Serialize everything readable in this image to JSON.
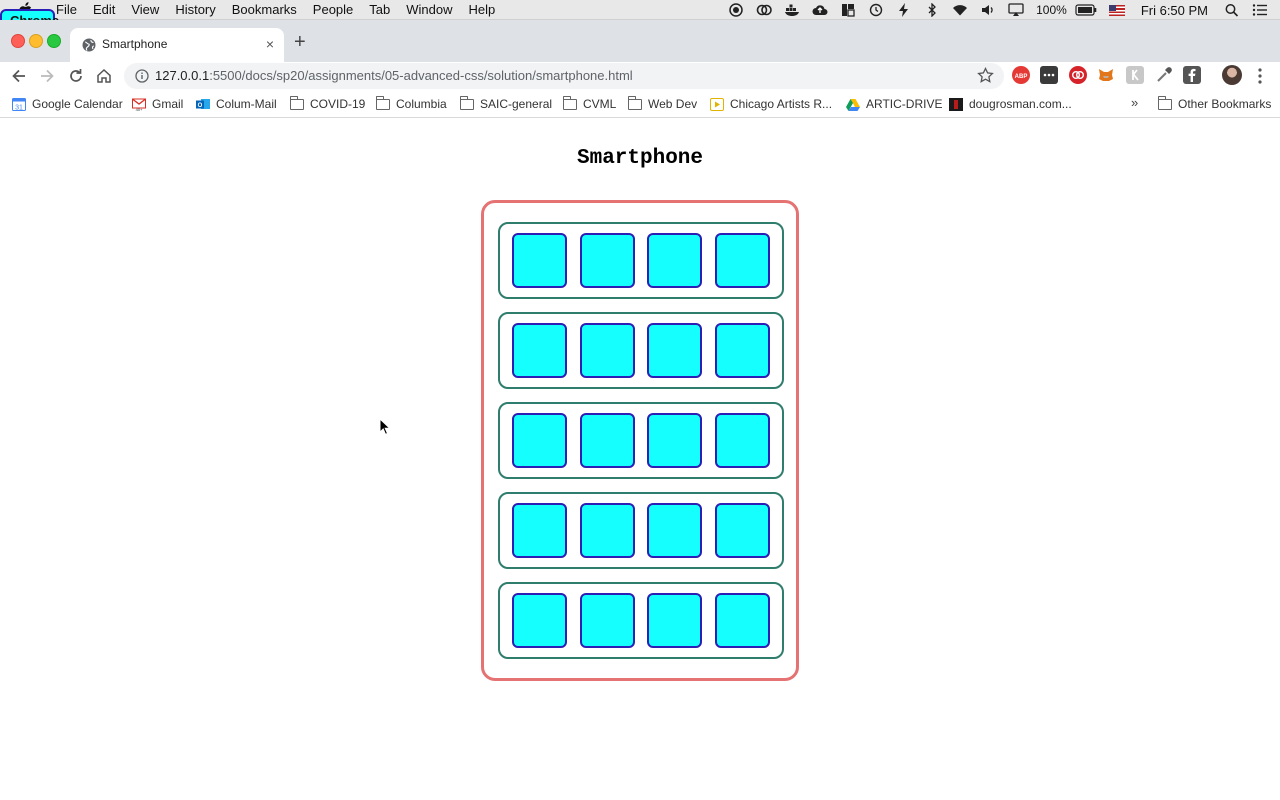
{
  "menubar": {
    "app_name": "Chrome",
    "items": [
      "File",
      "Edit",
      "View",
      "History",
      "Bookmarks",
      "People",
      "Tab",
      "Window",
      "Help"
    ],
    "battery": "100%",
    "clock": "Fri 6:50 PM"
  },
  "tab": {
    "title": "Smartphone",
    "close": "×"
  },
  "new_tab": "+",
  "toolbar": {
    "url_host": "127.0.0.1",
    "url_rest": ":5500/docs/sp20/assignments/05-advanced-css/solution/smartphone.html"
  },
  "bookmarks": {
    "items": [
      {
        "label": "Google Calendar",
        "icon": "calendar-icon"
      },
      {
        "label": "Gmail",
        "icon": "gmail-icon"
      },
      {
        "label": "Colum-Mail",
        "icon": "outlook-icon"
      },
      {
        "label": "COVID-19",
        "icon": "folder-icon"
      },
      {
        "label": "Columbia",
        "icon": "folder-icon"
      },
      {
        "label": "SAIC-general",
        "icon": "folder-icon"
      },
      {
        "label": "CVML",
        "icon": "folder-icon"
      },
      {
        "label": "Web Dev",
        "icon": "folder-icon"
      },
      {
        "label": "Chicago Artists R...",
        "icon": "page-icon"
      },
      {
        "label": "ARTIC-DRIVE",
        "icon": "drive-icon"
      },
      {
        "label": "dougrosman.com...",
        "icon": "site-icon"
      }
    ],
    "overflow": "»",
    "other": "Other Bookmarks"
  },
  "page": {
    "title": "Smartphone",
    "rows": 5,
    "apps_per_row": 4
  },
  "colors": {
    "phone_border": "#e57373",
    "row_border": "#2e7d6d",
    "app_fill": "#16ffff",
    "app_border": "#2c1fb5"
  }
}
